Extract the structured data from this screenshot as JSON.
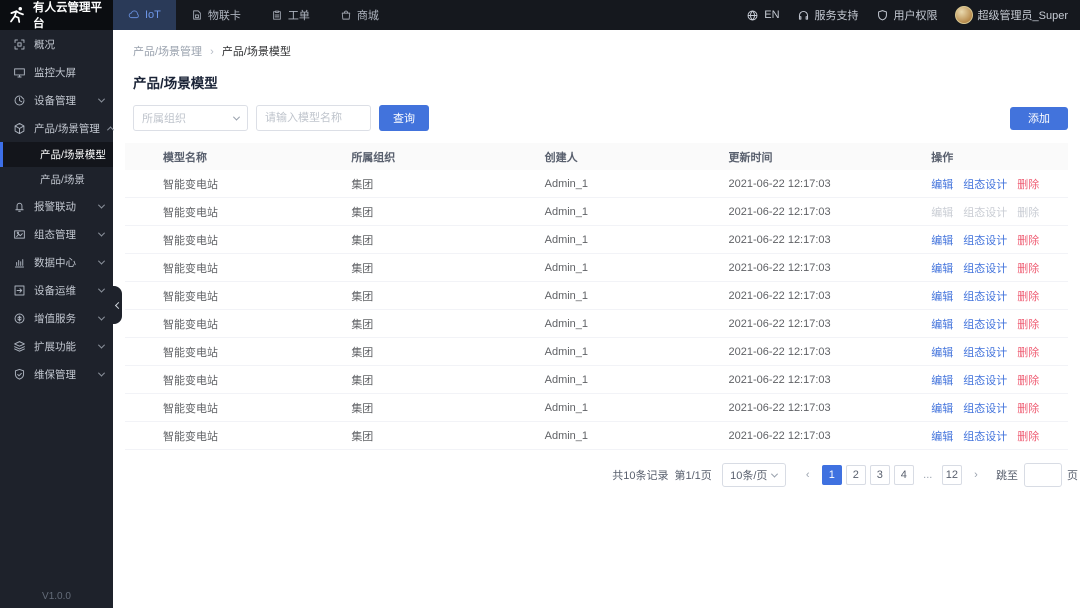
{
  "topbar": {
    "brand": "有人云管理平台",
    "nav": [
      {
        "label": "IoT",
        "icon": "cloud",
        "active": true
      },
      {
        "label": "物联卡",
        "icon": "sim-card",
        "active": false
      },
      {
        "label": "工单",
        "icon": "work-order",
        "active": false
      },
      {
        "label": "商城",
        "icon": "mall",
        "active": false
      }
    ],
    "right": [
      {
        "label": "EN",
        "icon": "globe"
      },
      {
        "label": "服务支持",
        "icon": "headset"
      },
      {
        "label": "用户权限",
        "icon": "shield"
      },
      {
        "label": "超级管理员_Super",
        "icon": "avatar"
      }
    ]
  },
  "sidebar": {
    "items": [
      {
        "label": "概况",
        "icon": "overview",
        "chevron": ""
      },
      {
        "label": "监控大屏",
        "icon": "monitor",
        "chevron": ""
      },
      {
        "label": "设备管理",
        "icon": "device-mgmt",
        "chevron": "down"
      },
      {
        "label": "产品/场景管理",
        "icon": "product-mgmt",
        "chevron": "up",
        "expanded": true
      },
      {
        "label": "报警联动",
        "icon": "alarm",
        "chevron": "down"
      },
      {
        "label": "组态管理",
        "icon": "scada",
        "chevron": "down"
      },
      {
        "label": "数据中心",
        "icon": "data-center",
        "chevron": "down"
      },
      {
        "label": "设备运维",
        "icon": "device-ops",
        "chevron": "down"
      },
      {
        "label": "增值服务",
        "icon": "value-service",
        "chevron": "down"
      },
      {
        "label": "扩展功能",
        "icon": "extension",
        "chevron": "down"
      },
      {
        "label": "维保管理",
        "icon": "maintenance",
        "chevron": "down"
      }
    ],
    "submenu": [
      {
        "label": "产品/场景模型",
        "active": true
      },
      {
        "label": "产品/场景",
        "active": false
      }
    ],
    "version": "V1.0.0"
  },
  "breadcrumb": {
    "parent": "产品/场景管理",
    "separator": "›",
    "current": "产品/场景模型"
  },
  "page": {
    "title": "产品/场景模型"
  },
  "filters": {
    "org_placeholder": "所属组织",
    "name_placeholder": "请输入模型名称",
    "search_label": "查询",
    "add_label": "添加"
  },
  "table": {
    "headers": [
      "模型名称",
      "所属组织",
      "创建人",
      "更新时间",
      "操作"
    ],
    "action_labels": [
      "编辑",
      "组态设计",
      "删除"
    ],
    "rows": [
      {
        "name": "智能变电站",
        "org": "集团",
        "creator": "Admin_1",
        "updated": "2021-06-22 12:17:03",
        "actions_disabled": false
      },
      {
        "name": "智能变电站",
        "org": "集团",
        "creator": "Admin_1",
        "updated": "2021-06-22 12:17:03",
        "actions_disabled": true
      },
      {
        "name": "智能变电站",
        "org": "集团",
        "creator": "Admin_1",
        "updated": "2021-06-22 12:17:03",
        "actions_disabled": false
      },
      {
        "name": "智能变电站",
        "org": "集团",
        "creator": "Admin_1",
        "updated": "2021-06-22 12:17:03",
        "actions_disabled": false
      },
      {
        "name": "智能变电站",
        "org": "集团",
        "creator": "Admin_1",
        "updated": "2021-06-22 12:17:03",
        "actions_disabled": false
      },
      {
        "name": "智能变电站",
        "org": "集团",
        "creator": "Admin_1",
        "updated": "2021-06-22 12:17:03",
        "actions_disabled": false
      },
      {
        "name": "智能变电站",
        "org": "集团",
        "creator": "Admin_1",
        "updated": "2021-06-22 12:17:03",
        "actions_disabled": false
      },
      {
        "name": "智能变电站",
        "org": "集团",
        "creator": "Admin_1",
        "updated": "2021-06-22 12:17:03",
        "actions_disabled": false
      },
      {
        "name": "智能变电站",
        "org": "集团",
        "creator": "Admin_1",
        "updated": "2021-06-22 12:17:03",
        "actions_disabled": false
      },
      {
        "name": "智能变电站",
        "org": "集团",
        "creator": "Admin_1",
        "updated": "2021-06-22 12:17:03",
        "actions_disabled": false
      }
    ]
  },
  "pagination": {
    "total_text": "共10条记录",
    "page_text": "第1/1页",
    "page_size": "10条/页",
    "prev": "‹",
    "next": "›",
    "pages": [
      "1",
      "2",
      "3",
      "4",
      "...",
      "12"
    ],
    "active_page": "1",
    "jump_label": "跳至",
    "jump_value": "",
    "jump_suffix": "页"
  },
  "colors": {
    "primary": "#4273dc",
    "danger": "#ef5e74",
    "topbar_bg": "#15181e",
    "sidebar_bg": "#1e222b",
    "active_nav_bg": "#2a3a58",
    "active_submenu_bar": "#3d6fe8"
  }
}
